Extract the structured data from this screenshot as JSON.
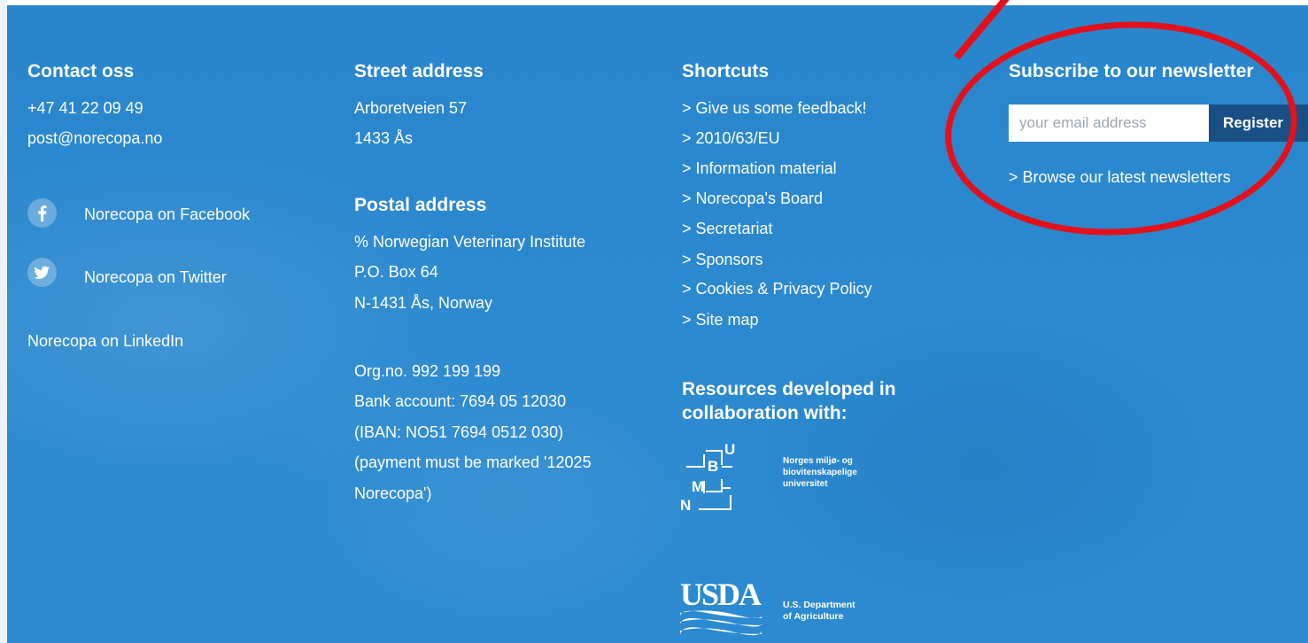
{
  "contact": {
    "heading": "Contact oss",
    "phone": "+47 41 22 09 49",
    "email": "post@norecopa.no",
    "facebook": "Norecopa on Facebook",
    "twitter": "Norecopa on Twitter",
    "linkedin": "Norecopa on LinkedIn"
  },
  "street": {
    "heading": "Street address",
    "line1": "Arboretveien 57",
    "line2": "1433 Ås"
  },
  "postal": {
    "heading": "Postal address",
    "line1": "% Norwegian Veterinary Institute",
    "line2": "P.O. Box 64",
    "line3": "N-1431 Ås, Norway"
  },
  "org": {
    "orgno": "Org.no. 992 199 199",
    "bank": "Bank account: 7694 05 12030",
    "iban": "(IBAN: NO51 7694 0512 030)",
    "note1": "(payment must be marked '12025",
    "note2": "Norecopa')"
  },
  "shortcuts": {
    "heading": "Shortcuts",
    "items": [
      "> Give us some feedback!",
      "> 2010/63/EU",
      "> Information material",
      "> Norecopa's Board",
      "> Secretariat",
      "> Sponsors",
      "> Cookies & Privacy Policy",
      "> Site map"
    ]
  },
  "resources": {
    "heading1": "Resources developed in",
    "heading2": "collaboration with:",
    "nmbu_letters": {
      "u": "U",
      "b": "B",
      "m": "M",
      "n": "N"
    },
    "nmbu_text1": "Norges miljø- og",
    "nmbu_text2": "biovitenskapelige",
    "nmbu_text3": "universitet",
    "usda_logo": "USDA",
    "usda_text1": "U.S. Department",
    "usda_text2": "of Agriculture"
  },
  "newsletter": {
    "heading": "Subscribe to our newsletter",
    "email_placeholder": "your email address",
    "register_label": "Register",
    "browse_link": "> Browse our latest newsletters"
  },
  "icons": {
    "facebook": "facebook-icon",
    "twitter": "twitter-icon"
  },
  "colors": {
    "background": "#2b89cf",
    "register_button": "#1a4f86",
    "annotation": "#e3111b"
  }
}
